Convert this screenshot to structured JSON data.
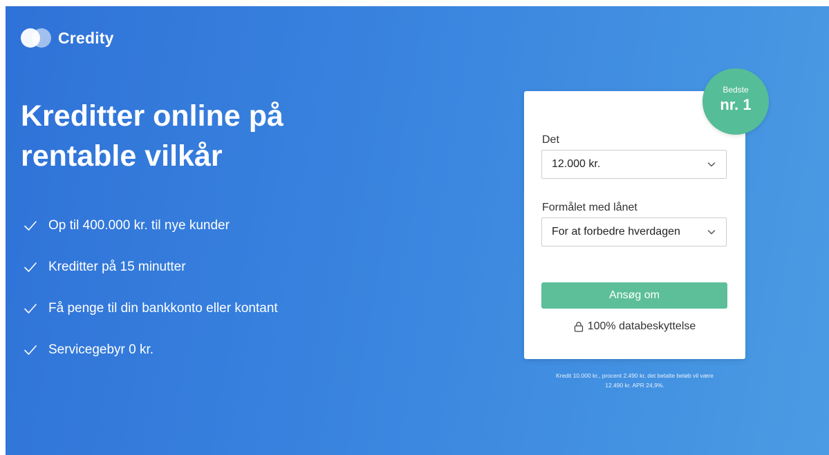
{
  "brand": {
    "name": "Credity"
  },
  "hero": {
    "headline_line1": "Kreditter online på",
    "headline_line2": "rentable vilkår",
    "features": [
      "Op til 400.000 kr. til nye kunder",
      "Kreditter på 15 minutter",
      "Få penge til din bankkonto eller kontant",
      "Servicegebyr 0 kr."
    ]
  },
  "badge": {
    "small": "Bedste",
    "big": "nr. 1"
  },
  "form": {
    "amount_label": "Det",
    "amount_value": "12.000 kr.",
    "purpose_label": "Formålet med lånet",
    "purpose_value": "For at forbedre hverdagen",
    "submit_label": "Ansøg om",
    "privacy_text": "100% databeskyttelse"
  },
  "disclaimer": {
    "line1": "Kredit 10.000 kr., procent 2.490 kr, det betalte beløb vil være",
    "line2": "12.490 kr. APR 24,9%."
  },
  "colors": {
    "gradient_start": "#2f72d8",
    "gradient_end": "#4a9be3",
    "accent_green": "#5cbf9a"
  },
  "icons": {
    "logo": "two-overlapping-circles-icon",
    "feature": "check-icon",
    "select": "chevron-down-icon",
    "privacy": "lock-icon"
  }
}
